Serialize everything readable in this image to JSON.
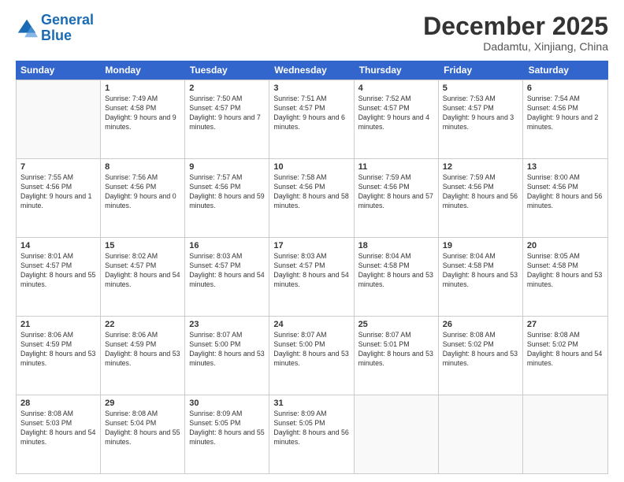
{
  "logo": {
    "line1": "General",
    "line2": "Blue"
  },
  "header": {
    "month": "December 2025",
    "location": "Dadamtu, Xinjiang, China"
  },
  "days": [
    "Sunday",
    "Monday",
    "Tuesday",
    "Wednesday",
    "Thursday",
    "Friday",
    "Saturday"
  ],
  "weeks": [
    [
      {
        "day": "",
        "empty": true
      },
      {
        "day": "1",
        "sunrise": "7:49 AM",
        "sunset": "4:58 PM",
        "daylight": "9 hours and 9 minutes."
      },
      {
        "day": "2",
        "sunrise": "7:50 AM",
        "sunset": "4:57 PM",
        "daylight": "9 hours and 7 minutes."
      },
      {
        "day": "3",
        "sunrise": "7:51 AM",
        "sunset": "4:57 PM",
        "daylight": "9 hours and 6 minutes."
      },
      {
        "day": "4",
        "sunrise": "7:52 AM",
        "sunset": "4:57 PM",
        "daylight": "9 hours and 4 minutes."
      },
      {
        "day": "5",
        "sunrise": "7:53 AM",
        "sunset": "4:57 PM",
        "daylight": "9 hours and 3 minutes."
      },
      {
        "day": "6",
        "sunrise": "7:54 AM",
        "sunset": "4:56 PM",
        "daylight": "9 hours and 2 minutes."
      }
    ],
    [
      {
        "day": "7",
        "sunrise": "7:55 AM",
        "sunset": "4:56 PM",
        "daylight": "9 hours and 1 minute."
      },
      {
        "day": "8",
        "sunrise": "7:56 AM",
        "sunset": "4:56 PM",
        "daylight": "9 hours and 0 minutes."
      },
      {
        "day": "9",
        "sunrise": "7:57 AM",
        "sunset": "4:56 PM",
        "daylight": "8 hours and 59 minutes."
      },
      {
        "day": "10",
        "sunrise": "7:58 AM",
        "sunset": "4:56 PM",
        "daylight": "8 hours and 58 minutes."
      },
      {
        "day": "11",
        "sunrise": "7:59 AM",
        "sunset": "4:56 PM",
        "daylight": "8 hours and 57 minutes."
      },
      {
        "day": "12",
        "sunrise": "7:59 AM",
        "sunset": "4:56 PM",
        "daylight": "8 hours and 56 minutes."
      },
      {
        "day": "13",
        "sunrise": "8:00 AM",
        "sunset": "4:56 PM",
        "daylight": "8 hours and 56 minutes."
      }
    ],
    [
      {
        "day": "14",
        "sunrise": "8:01 AM",
        "sunset": "4:57 PM",
        "daylight": "8 hours and 55 minutes."
      },
      {
        "day": "15",
        "sunrise": "8:02 AM",
        "sunset": "4:57 PM",
        "daylight": "8 hours and 54 minutes."
      },
      {
        "day": "16",
        "sunrise": "8:03 AM",
        "sunset": "4:57 PM",
        "daylight": "8 hours and 54 minutes."
      },
      {
        "day": "17",
        "sunrise": "8:03 AM",
        "sunset": "4:57 PM",
        "daylight": "8 hours and 54 minutes."
      },
      {
        "day": "18",
        "sunrise": "8:04 AM",
        "sunset": "4:58 PM",
        "daylight": "8 hours and 53 minutes."
      },
      {
        "day": "19",
        "sunrise": "8:04 AM",
        "sunset": "4:58 PM",
        "daylight": "8 hours and 53 minutes."
      },
      {
        "day": "20",
        "sunrise": "8:05 AM",
        "sunset": "4:58 PM",
        "daylight": "8 hours and 53 minutes."
      }
    ],
    [
      {
        "day": "21",
        "sunrise": "8:06 AM",
        "sunset": "4:59 PM",
        "daylight": "8 hours and 53 minutes."
      },
      {
        "day": "22",
        "sunrise": "8:06 AM",
        "sunset": "4:59 PM",
        "daylight": "8 hours and 53 minutes."
      },
      {
        "day": "23",
        "sunrise": "8:07 AM",
        "sunset": "5:00 PM",
        "daylight": "8 hours and 53 minutes."
      },
      {
        "day": "24",
        "sunrise": "8:07 AM",
        "sunset": "5:00 PM",
        "daylight": "8 hours and 53 minutes."
      },
      {
        "day": "25",
        "sunrise": "8:07 AM",
        "sunset": "5:01 PM",
        "daylight": "8 hours and 53 minutes."
      },
      {
        "day": "26",
        "sunrise": "8:08 AM",
        "sunset": "5:02 PM",
        "daylight": "8 hours and 53 minutes."
      },
      {
        "day": "27",
        "sunrise": "8:08 AM",
        "sunset": "5:02 PM",
        "daylight": "8 hours and 54 minutes."
      }
    ],
    [
      {
        "day": "28",
        "sunrise": "8:08 AM",
        "sunset": "5:03 PM",
        "daylight": "8 hours and 54 minutes."
      },
      {
        "day": "29",
        "sunrise": "8:08 AM",
        "sunset": "5:04 PM",
        "daylight": "8 hours and 55 minutes."
      },
      {
        "day": "30",
        "sunrise": "8:09 AM",
        "sunset": "5:05 PM",
        "daylight": "8 hours and 55 minutes."
      },
      {
        "day": "31",
        "sunrise": "8:09 AM",
        "sunset": "5:05 PM",
        "daylight": "8 hours and 56 minutes."
      },
      {
        "day": "",
        "empty": true
      },
      {
        "day": "",
        "empty": true
      },
      {
        "day": "",
        "empty": true
      }
    ]
  ]
}
